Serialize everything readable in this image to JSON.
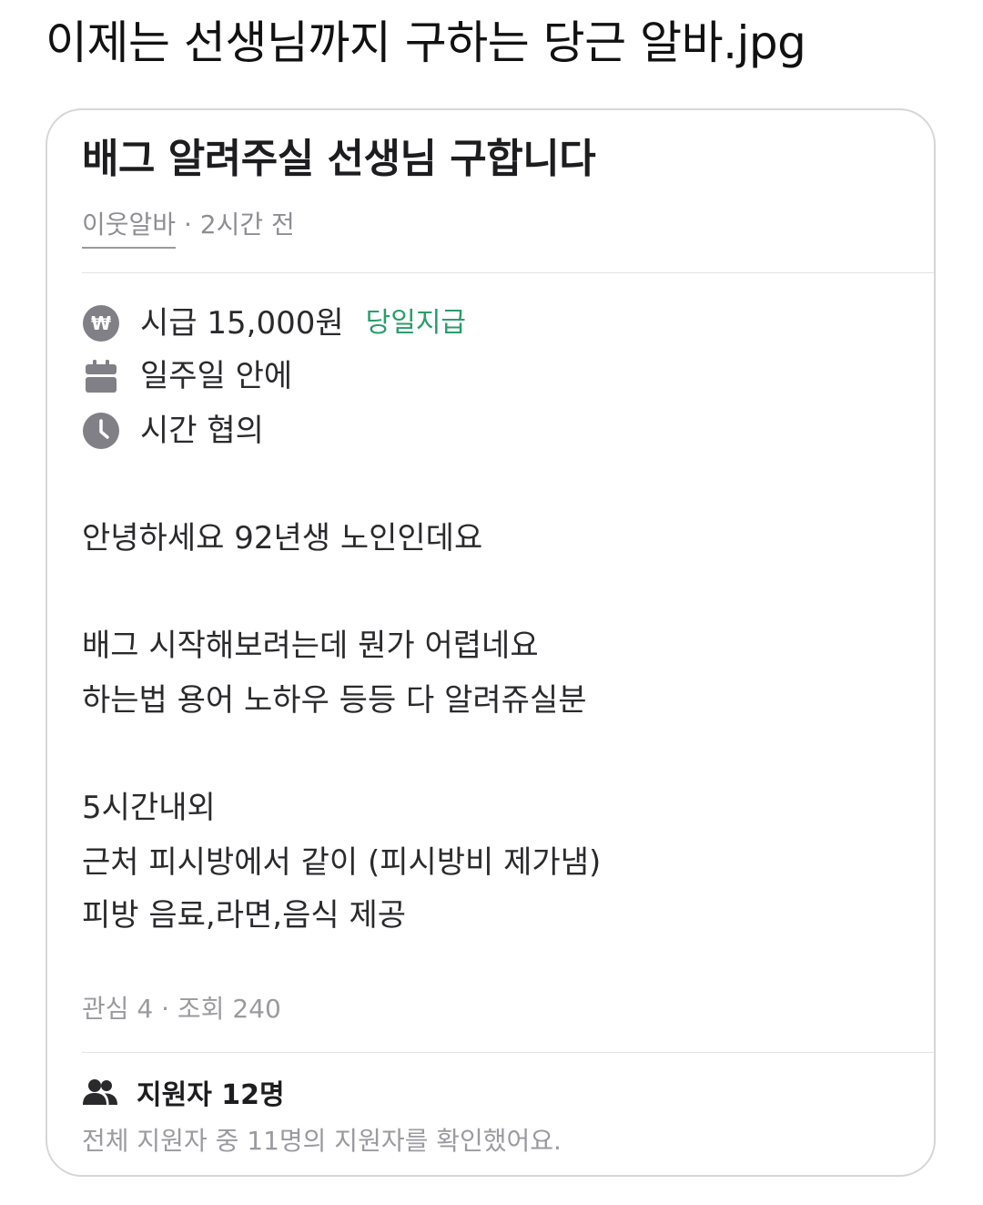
{
  "page_title": "이제는 선생님까지 구하는 당근 알바.jpg",
  "job": {
    "title": "배그 알려주실 선생님 구합니다",
    "poster": "이웃알바",
    "time_ago": "· 2시간 전",
    "info": {
      "pay": {
        "icon": "won-icon",
        "text": "시급 15,000원",
        "tag": "당일지급"
      },
      "schedule": {
        "icon": "calendar-icon",
        "text": "일주일 안에"
      },
      "time": {
        "icon": "clock-icon",
        "text": "시간 협의"
      }
    },
    "body": [
      "안녕하세요 92년생 노인인데요",
      "배그 시작해보려는데 뭔가 어렵네요",
      "하는법 용어 노하우 등등 다 알려쥬실분",
      "5시간내외",
      "근처 피시방에서 같이 (피시방비 제가냄)",
      "피방 음료,라면,음식 제공"
    ],
    "stats": "관심 4 · 조회 240",
    "applicants": {
      "icon": "people-icon",
      "label": "지원자 12명",
      "note": "전체 지원자 중 11명의 지원자를 확인했어요."
    }
  },
  "colors": {
    "accent_green": "#2a9d6a",
    "icon_gray": "#808086",
    "muted_text": "#8e8e93",
    "border": "#d6d6d9"
  }
}
